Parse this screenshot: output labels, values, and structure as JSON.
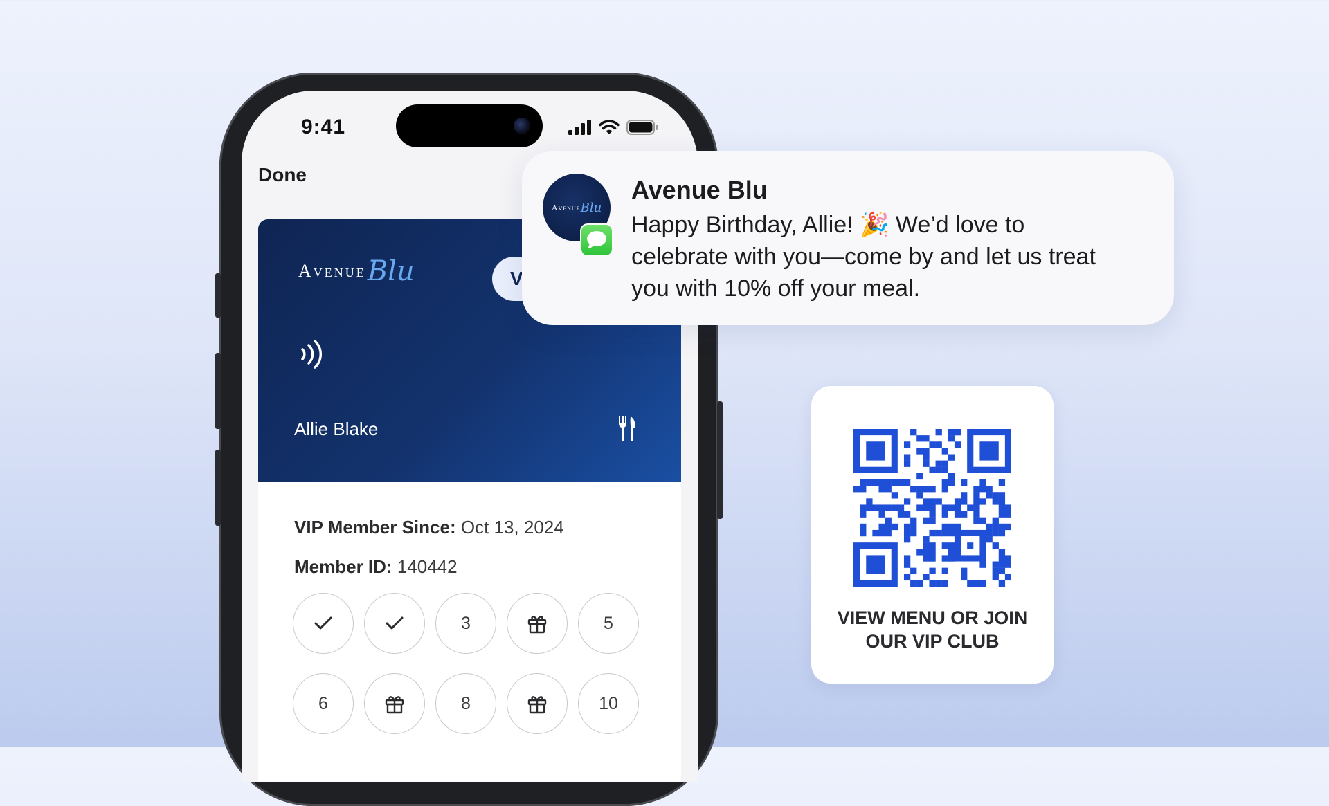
{
  "phone": {
    "status_bar": {
      "time": "9:41"
    },
    "done_label": "Done",
    "card": {
      "logo_text": "Avenue",
      "logo_script": "Blu",
      "pill_text": "V",
      "holder_name": "Allie Blake"
    },
    "details": {
      "member_since_label": "VIP Member Since:",
      "member_since_value": "Oct 13, 2024",
      "member_id_label": "Member ID:",
      "member_id_value": "140442"
    },
    "stamps": [
      {
        "type": "check",
        "label": ""
      },
      {
        "type": "check",
        "label": ""
      },
      {
        "type": "number",
        "label": "3"
      },
      {
        "type": "gift",
        "label": ""
      },
      {
        "type": "number",
        "label": "5"
      },
      {
        "type": "number",
        "label": "6"
      },
      {
        "type": "gift",
        "label": ""
      },
      {
        "type": "number",
        "label": "8"
      },
      {
        "type": "gift",
        "label": ""
      },
      {
        "type": "number",
        "label": "10"
      }
    ]
  },
  "notification": {
    "avatar_text": "Avenue",
    "avatar_script": "Blu",
    "title": "Avenue Blu",
    "line1": "Happy Birthday, Allie! 🎉 We’d love to",
    "line2": "celebrate with you—come by and let us treat",
    "line3": "you with 10% off your meal."
  },
  "qr_card": {
    "caption_line1": "VIEW MENU OR JOIN",
    "caption_line2": "OUR VIP CLUB",
    "qr_color": "#1f4fd6"
  },
  "colors": {
    "card_dark": "#0f2553",
    "card_light": "#1a4fa3",
    "accent_blue": "#6aa9f0",
    "messages_green": "#34c759"
  }
}
